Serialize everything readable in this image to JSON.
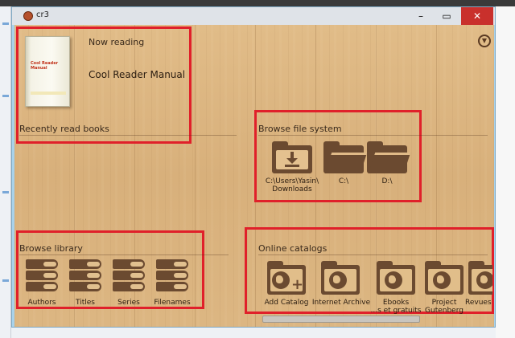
{
  "window": {
    "title": "cr3",
    "minimize": "–",
    "maximize": "▭",
    "close": "✕"
  },
  "menu_icon": "chevron-down-icon",
  "now_reading": {
    "label": "Now reading",
    "book_title": "Cool Reader Manual",
    "cover_text": "Cool Reader Manual"
  },
  "recent": {
    "label": "Recently read books"
  },
  "filesystem": {
    "label": "Browse file system",
    "items": [
      {
        "label_line1": "C:\\Users\\Yasin\\",
        "label_line2": "Downloads",
        "icon": "download-folder-icon"
      },
      {
        "label_line1": "C:\\",
        "label_line2": "",
        "icon": "folder-open-icon"
      },
      {
        "label_line1": "D:\\",
        "label_line2": "",
        "icon": "folder-open-icon"
      }
    ]
  },
  "library": {
    "label": "Browse library",
    "items": [
      {
        "label": "Authors",
        "icon": "books-stack-icon"
      },
      {
        "label": "Titles",
        "icon": "books-stack-icon"
      },
      {
        "label": "Series",
        "icon": "books-stack-icon"
      },
      {
        "label": "Filenames",
        "icon": "books-stack-icon"
      }
    ]
  },
  "catalogs": {
    "label": "Online catalogs",
    "items": [
      {
        "label_line1": "Add Catalog",
        "label_line2": "",
        "icon": "globe-folder-add-icon"
      },
      {
        "label_line1": "Internet Archive",
        "label_line2": "",
        "icon": "globe-folder-icon"
      },
      {
        "label_line1": "Ebooks",
        "label_line2": "...s et gratuits",
        "icon": "globe-folder-icon"
      },
      {
        "label_line1": "Project",
        "label_line2": "Gutenberg",
        "icon": "globe-folder-icon"
      },
      {
        "label_line1": "Revues",
        "label_line2": "",
        "icon": "globe-folder-icon"
      }
    ]
  },
  "colors": {
    "highlight": "#e0202a",
    "icon": "#6b4a30",
    "close_button": "#c9302c"
  }
}
